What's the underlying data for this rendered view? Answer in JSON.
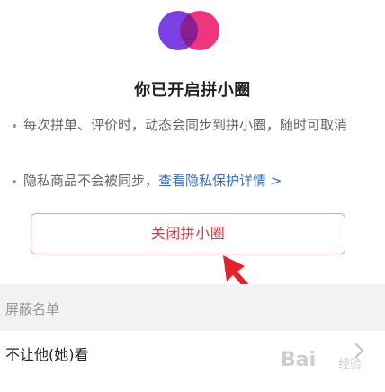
{
  "header": {
    "logo_icon": "overlapping-circles-logo-icon",
    "title": "你已开启拼小圈"
  },
  "bullets": [
    {
      "text": "每次拼单、评价时，动态会同步到拼小圈，随时可取消"
    },
    {
      "text": "隐私商品不会被同步，",
      "link": "查看隐私保护详情",
      "link_arrow": ">"
    }
  ],
  "actions": {
    "close_label": "关闭拼小圈"
  },
  "block_list": {
    "section_title": "屏蔽名单",
    "row_label": "不让他(她)看",
    "row_icon": "chevron-right-icon"
  },
  "watermark": {
    "text": "Bai",
    "sub": "经验"
  },
  "colors": {
    "accent_red": "#e2333a",
    "link_blue": "#3b6fc7",
    "logo_purple": "#7b3fe4",
    "logo_pink": "#f0357f"
  }
}
